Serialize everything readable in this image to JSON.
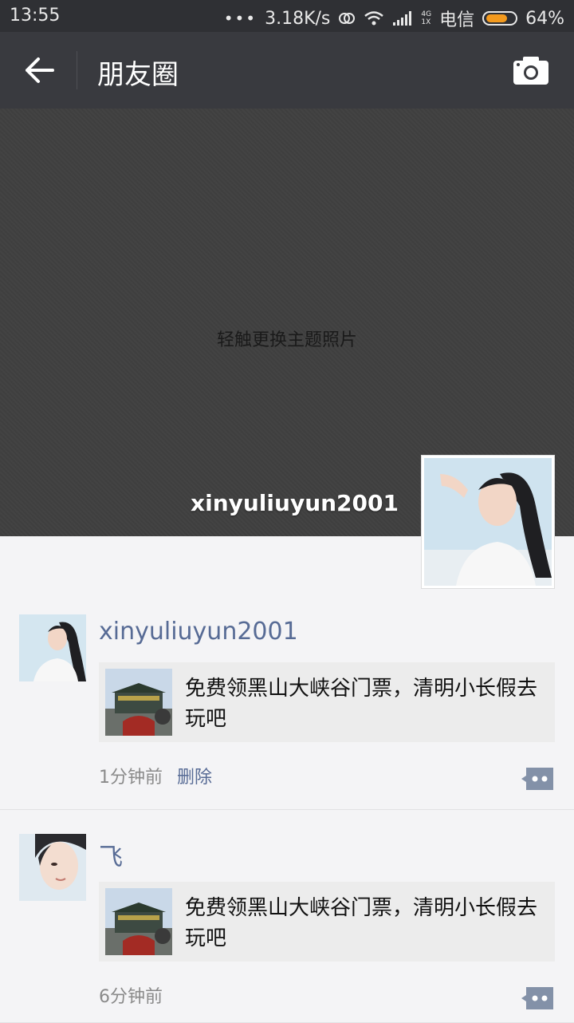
{
  "status_bar": {
    "time": "13:55",
    "dots": "•••",
    "speed": "3.18K/s",
    "network_top": "4G",
    "network_bottom": "1X",
    "carrier": "电信",
    "battery": "64%"
  },
  "nav": {
    "title": "朋友圈",
    "back_icon": "arrow-left-icon",
    "camera_icon": "camera-icon"
  },
  "cover": {
    "hint": "轻触更换主题照片"
  },
  "profile": {
    "name": "xinyuliuyun2001"
  },
  "posts": [
    {
      "author": "xinyuliuyun2001",
      "share_text": "免费领黑山大峡谷门票，清明小长假去玩吧",
      "time": "1分钟前",
      "delete_label": "删除"
    },
    {
      "author": "飞",
      "share_text": "免费领黑山大峡谷门票，清明小长假去玩吧",
      "time": "6分钟前"
    }
  ],
  "colors": {
    "nav_bg": "#393a3f",
    "link": "#576b95",
    "battery": "#f39a1e"
  }
}
